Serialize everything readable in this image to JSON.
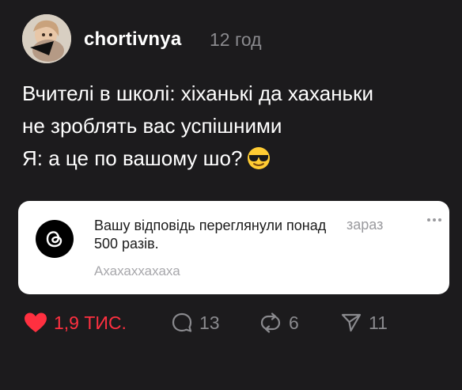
{
  "post": {
    "username": "chortivnya",
    "timestamp": "12 год",
    "text_lines": [
      "Вчителі в школі: хіханькі да хаханьки",
      "не зроблять вас успішними",
      "Я: а це по вашому шо?"
    ],
    "emoji": "sunglasses-face"
  },
  "notification": {
    "app_icon": "threads-icon",
    "message": "Вашу відповідь переглянули понад 500 разів.",
    "time": "зараз",
    "reply_text": "Ахахаххахаха"
  },
  "actions": {
    "likes": "1,9 ТИС.",
    "comments": "13",
    "reposts": "6",
    "shares": "11"
  },
  "colors": {
    "background": "#1c1b1d",
    "like_red": "#ff3040",
    "muted": "#8a8a8e"
  }
}
